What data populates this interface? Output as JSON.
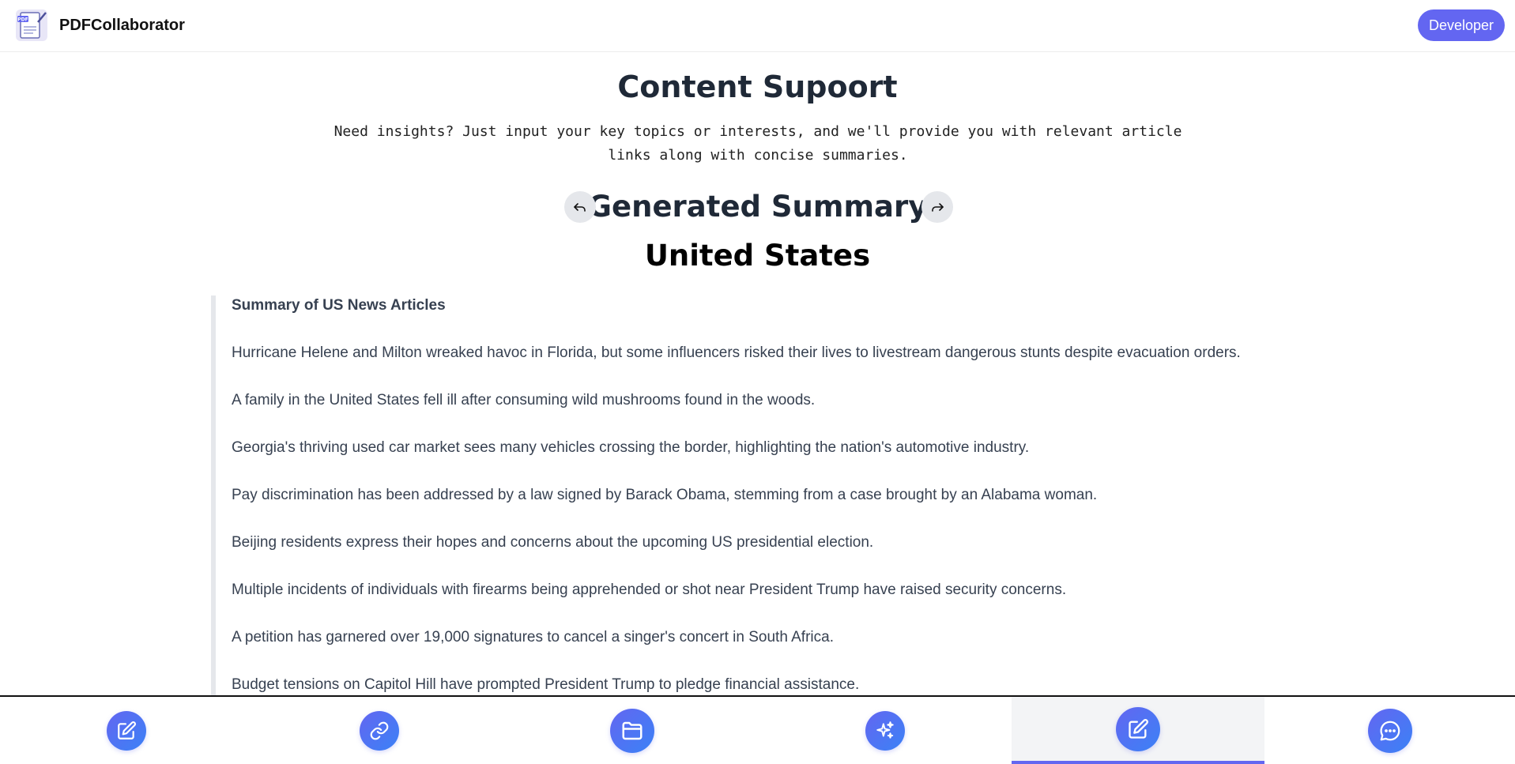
{
  "header": {
    "app_name": "PDFCollaborator",
    "logo_icon": "pdf-document-logo",
    "developer_label": "Developer"
  },
  "page": {
    "title": "Content Supoort",
    "subtitle": "Need insights? Just input your key topics or interests, and we'll provide you with relevant article links along with concise summaries."
  },
  "summary": {
    "heading": "Generated Summary",
    "prev_icon": "undo-arrow-icon",
    "next_icon": "redo-arrow-icon",
    "country": "United States",
    "section_title": "Summary of US News Articles",
    "items": [
      "Hurricane Helene and Milton wreaked havoc in Florida, but some influencers risked their lives to livestream dangerous stunts despite evacuation orders.",
      "A family in the United States fell ill after consuming wild mushrooms found in the woods.",
      "Georgia's thriving used car market sees many vehicles crossing the border, highlighting the nation's automotive industry.",
      "Pay discrimination has been addressed by a law signed by Barack Obama, stemming from a case brought by an Alabama woman.",
      "Beijing residents express their hopes and concerns about the upcoming US presidential election.",
      "Multiple incidents of individuals with firearms being apprehended or shot near President Trump have raised security concerns.",
      "A petition has garnered over 19,000 signatures to cancel a singer's concert in South Africa.",
      "Budget tensions on Capitol Hill have prompted President Trump to pledge financial assistance."
    ]
  },
  "bottom_nav": {
    "items": [
      {
        "icon": "edit-icon",
        "active": false
      },
      {
        "icon": "link-icon",
        "active": false
      },
      {
        "icon": "folder-icon",
        "active": false
      },
      {
        "icon": "sparkles-icon",
        "active": false
      },
      {
        "icon": "edit-square-icon",
        "active": true
      },
      {
        "icon": "chat-icon",
        "active": false
      }
    ]
  },
  "colors": {
    "accent": "#6366f1",
    "accent_secondary": "#3b82f6",
    "text_dark": "#1f2937",
    "text_body": "#374151",
    "quote_border": "#e5e7eb"
  }
}
